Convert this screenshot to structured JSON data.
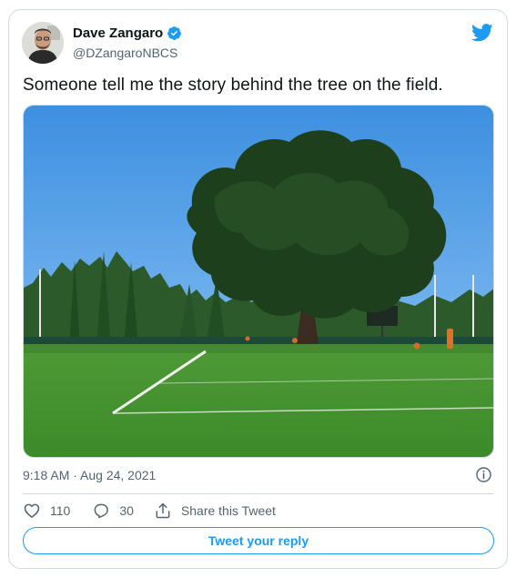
{
  "author": {
    "name": "Dave Zangaro",
    "handle": "@DZangaroNBCS",
    "verified": true
  },
  "tweet": {
    "text": "Someone tell me the story behind the tree on the field.",
    "timestamp": "9:18 AM · Aug 24, 2021"
  },
  "actions": {
    "likes": "110",
    "replies": "30",
    "share_label": "Share this Tweet"
  },
  "reply_button_label": "Tweet your reply",
  "colors": {
    "accent": "#1d9bf0",
    "secondary_text": "#536471",
    "border": "#cfd9de"
  },
  "icons": [
    "verified-badge-icon",
    "twitter-bird-icon",
    "info-icon",
    "heart-icon",
    "reply-bubble-icon",
    "share-icon"
  ]
}
